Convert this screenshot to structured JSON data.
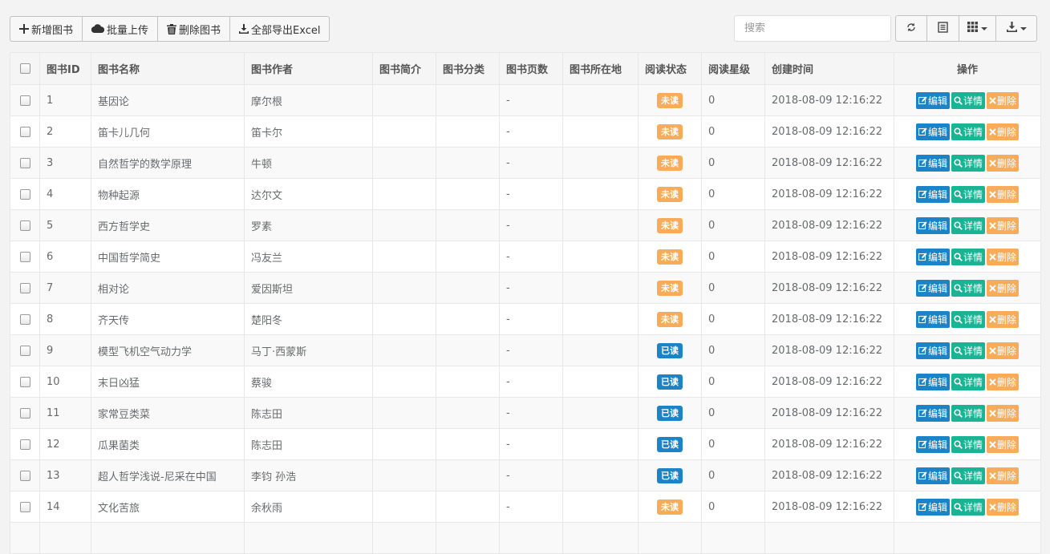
{
  "toolbar": {
    "add_label": "新增图书",
    "upload_label": "批量上传",
    "delete_label": "删除图书",
    "export_label": "全部导出Excel"
  },
  "search": {
    "placeholder": "搜索"
  },
  "table": {
    "headers": {
      "id": "图书ID",
      "name": "图书名称",
      "author": "图书作者",
      "intro": "图书简介",
      "category": "图书分类",
      "pages": "图书页数",
      "location": "图书所在地",
      "status": "阅读状态",
      "stars": "阅读星级",
      "created": "创建时间",
      "ops": "操作"
    },
    "actions": {
      "edit": "编辑",
      "detail": "详情",
      "delete": "删除"
    },
    "status_colors": {
      "未读": "#f8ac59",
      "已读": "#1c84c6"
    },
    "rows": [
      {
        "id": "1",
        "name": "基因论",
        "author": "摩尔根",
        "intro": "",
        "category": "",
        "pages": "-",
        "location": "",
        "status": "未读",
        "stars": "0",
        "created": "2018-08-09 12:16:22"
      },
      {
        "id": "2",
        "name": "笛卡儿几何",
        "author": "笛卡尔",
        "intro": "",
        "category": "",
        "pages": "-",
        "location": "",
        "status": "未读",
        "stars": "0",
        "created": "2018-08-09 12:16:22"
      },
      {
        "id": "3",
        "name": "自然哲学的数学原理",
        "author": "牛顿",
        "intro": "",
        "category": "",
        "pages": "-",
        "location": "",
        "status": "未读",
        "stars": "0",
        "created": "2018-08-09 12:16:22"
      },
      {
        "id": "4",
        "name": "物种起源",
        "author": "达尔文",
        "intro": "",
        "category": "",
        "pages": "-",
        "location": "",
        "status": "未读",
        "stars": "0",
        "created": "2018-08-09 12:16:22"
      },
      {
        "id": "5",
        "name": "西方哲学史",
        "author": "罗素",
        "intro": "",
        "category": "",
        "pages": "-",
        "location": "",
        "status": "未读",
        "stars": "0",
        "created": "2018-08-09 12:16:22"
      },
      {
        "id": "6",
        "name": "中国哲学简史",
        "author": "冯友兰",
        "intro": "",
        "category": "",
        "pages": "-",
        "location": "",
        "status": "未读",
        "stars": "0",
        "created": "2018-08-09 12:16:22"
      },
      {
        "id": "7",
        "name": "相对论",
        "author": "爱因斯坦",
        "intro": "",
        "category": "",
        "pages": "-",
        "location": "",
        "status": "未读",
        "stars": "0",
        "created": "2018-08-09 12:16:22"
      },
      {
        "id": "8",
        "name": "齐天传",
        "author": "楚阳冬",
        "intro": "",
        "category": "",
        "pages": "-",
        "location": "",
        "status": "未读",
        "stars": "0",
        "created": "2018-08-09 12:16:22"
      },
      {
        "id": "9",
        "name": "模型飞机空气动力学",
        "author": "马丁·西蒙斯",
        "intro": "",
        "category": "",
        "pages": "-",
        "location": "",
        "status": "已读",
        "stars": "0",
        "created": "2018-08-09 12:16:22"
      },
      {
        "id": "10",
        "name": "末日凶猛",
        "author": "蔡骏",
        "intro": "",
        "category": "",
        "pages": "-",
        "location": "",
        "status": "已读",
        "stars": "0",
        "created": "2018-08-09 12:16:22"
      },
      {
        "id": "11",
        "name": "家常豆类菜",
        "author": "陈志田",
        "intro": "",
        "category": "",
        "pages": "-",
        "location": "",
        "status": "已读",
        "stars": "0",
        "created": "2018-08-09 12:16:22"
      },
      {
        "id": "12",
        "name": "瓜果菌类",
        "author": "陈志田",
        "intro": "",
        "category": "",
        "pages": "-",
        "location": "",
        "status": "已读",
        "stars": "0",
        "created": "2018-08-09 12:16:22"
      },
      {
        "id": "13",
        "name": "超人哲学浅说-尼采在中国",
        "author": "李钧 孙浩",
        "intro": "",
        "category": "",
        "pages": "-",
        "location": "",
        "status": "已读",
        "stars": "0",
        "created": "2018-08-09 12:16:22"
      },
      {
        "id": "14",
        "name": "文化苦旅",
        "author": "余秋雨",
        "intro": "",
        "category": "",
        "pages": "-",
        "location": "",
        "status": "未读",
        "stars": "0",
        "created": "2018-08-09 12:16:22"
      },
      {
        "id": "",
        "name": "",
        "author": "",
        "intro": "",
        "category": "",
        "pages": "",
        "location": "",
        "status": "",
        "stars": "",
        "created": ""
      }
    ]
  },
  "icons": {
    "add": "plus-icon",
    "upload": "cloud-upload-icon",
    "delete": "trash-icon",
    "export": "download-icon",
    "refresh": "refresh-icon",
    "toggle": "list-icon",
    "columns": "grid-icon",
    "export_menu": "download-icon",
    "edit": "edit-icon",
    "detail": "search-icon",
    "remove": "close-icon"
  }
}
